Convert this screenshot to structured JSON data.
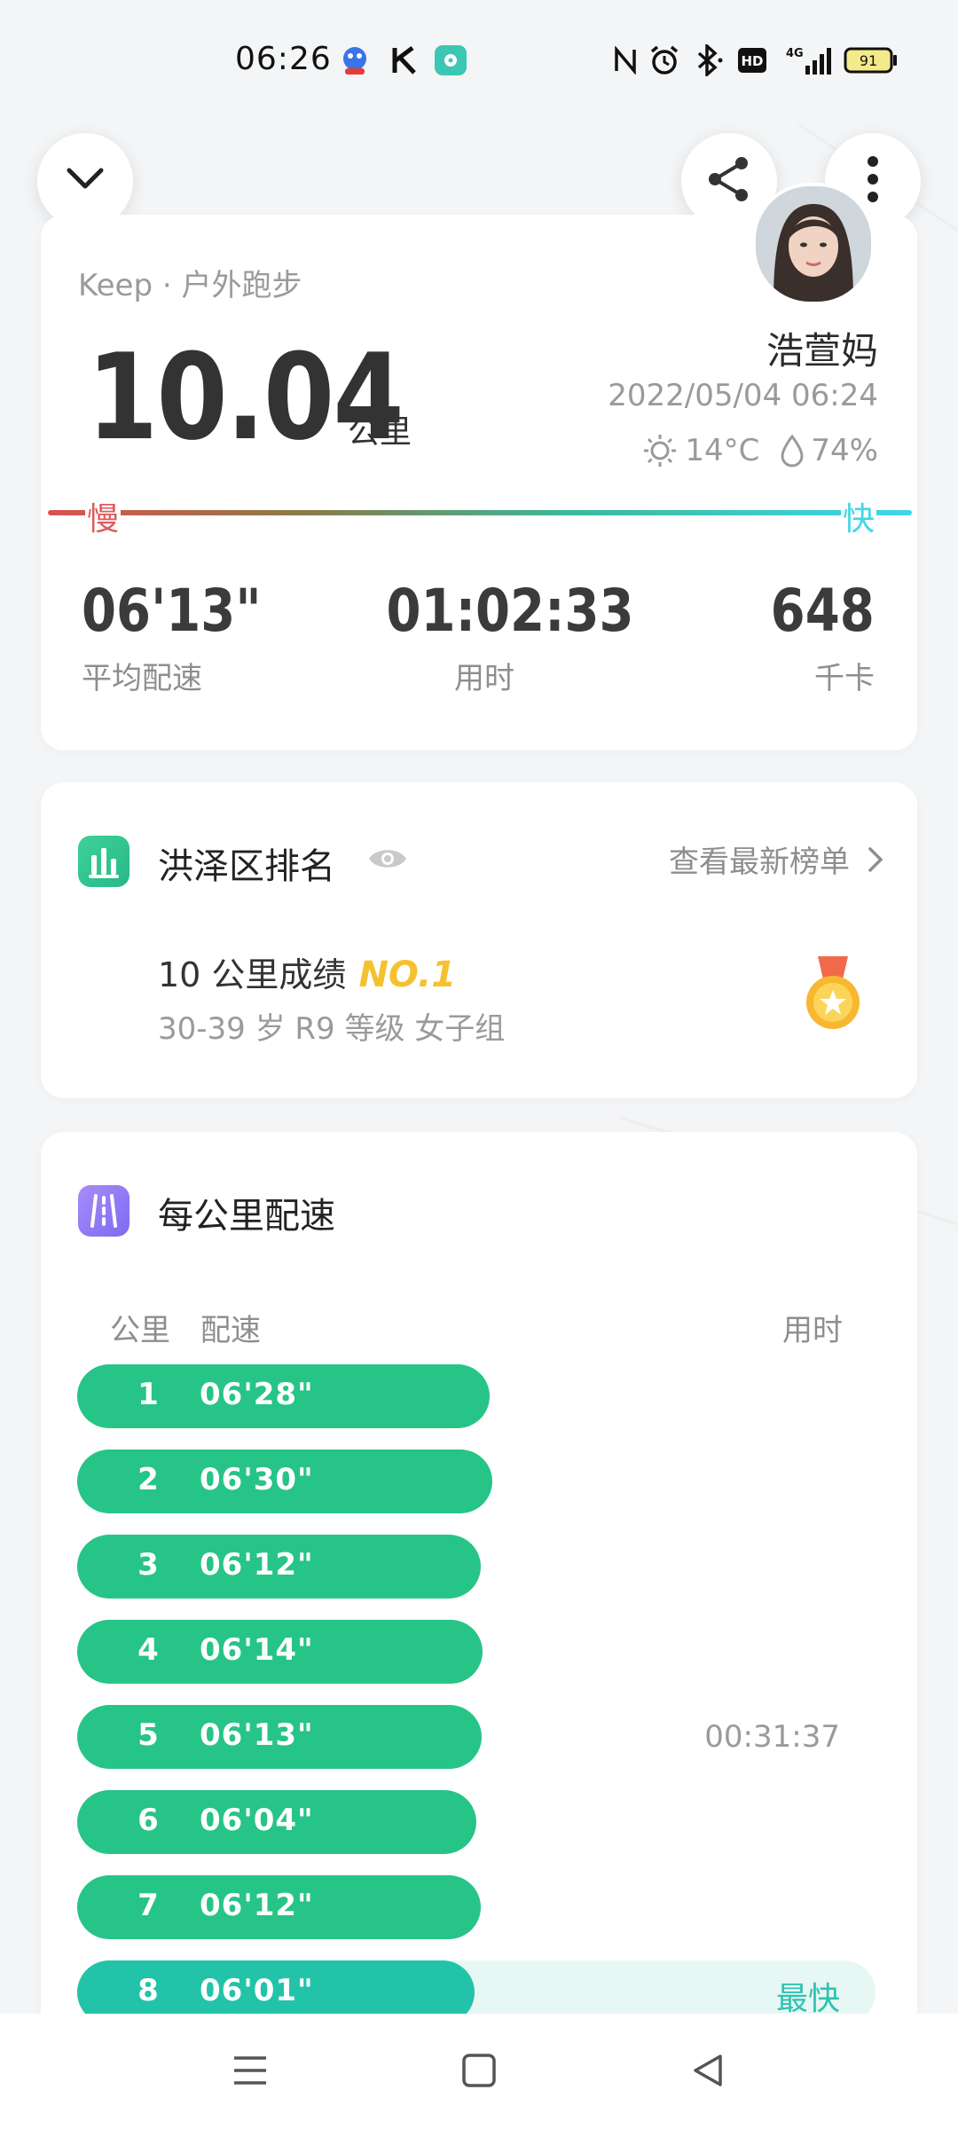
{
  "status_bar": {
    "time": "06:26",
    "battery": "91"
  },
  "summary": {
    "source": "Keep · 户外跑步",
    "distance": "10.04",
    "distance_unit": "公里",
    "user_name": "浩萱妈",
    "datetime": "2022/05/04 06:24",
    "temperature": "14°C",
    "humidity": "74%",
    "slow_label": "慢",
    "fast_label": "快",
    "stats": [
      {
        "value": "06'13\"",
        "label": "平均配速"
      },
      {
        "value": "01:02:33",
        "label": "用时"
      },
      {
        "value": "648",
        "label": "千卡"
      }
    ]
  },
  "ranking": {
    "title": "洪泽区排名",
    "link": "查看最新榜单",
    "result_prefix": "10 公里成绩",
    "result_rank": "NO.1",
    "group": "30-39 岁 R9 等级 女子组"
  },
  "splits": {
    "title": "每公里配速",
    "col_km": "公里",
    "col_pace": "配速",
    "col_time": "用时",
    "rows": [
      {
        "km": "1",
        "pace": "06'28\"",
        "time": "",
        "bar": 0.465
      },
      {
        "km": "2",
        "pace": "06'30\"",
        "time": "",
        "bar": 0.468
      },
      {
        "km": "3",
        "pace": "06'12\"",
        "time": "",
        "bar": 0.455
      },
      {
        "km": "4",
        "pace": "06'14\"",
        "time": "",
        "bar": 0.457
      },
      {
        "km": "5",
        "pace": "06'13\"",
        "time": "00:31:37",
        "bar": 0.456
      },
      {
        "km": "6",
        "pace": "06'04\"",
        "time": "",
        "bar": 0.45
      },
      {
        "km": "7",
        "pace": "06'12\"",
        "time": "",
        "bar": 0.455
      },
      {
        "km": "8",
        "pace": "06'01\"",
        "time": "",
        "bar": 0.448,
        "best": "最快"
      }
    ]
  },
  "colors": {
    "pace_green": "#27c487",
    "rank_gold": "#f5c12e",
    "slow_red": "#e05a5a",
    "fast_cyan": "#3fd6e8"
  }
}
